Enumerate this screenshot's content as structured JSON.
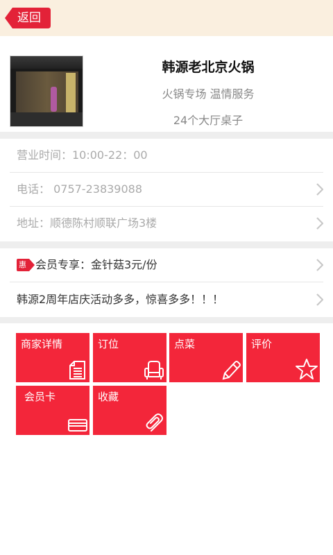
{
  "header": {
    "back_label": "返回"
  },
  "store": {
    "name": "韩源老北京火锅",
    "tagline": "火锅专场 温情服务",
    "tables": "24个大厅桌子",
    "photo_icon": "storefront-photo"
  },
  "info": {
    "hours": "营业时间：10:00-22：00",
    "phone": "电话： 0757-23839088",
    "address": "地址：顺德陈村顺联广场3楼"
  },
  "promos": {
    "badge": "惠",
    "member_offer": "会员专享：金针菇3元/份",
    "anniversary": "韩源2周年店庆活动多多，惊喜多多！！！"
  },
  "actions": [
    {
      "label": "商家详情",
      "icon": "document-icon"
    },
    {
      "label": "订位",
      "icon": "armchair-icon"
    },
    {
      "label": "点菜",
      "icon": "pencil-icon"
    },
    {
      "label": "评价",
      "icon": "star-icon"
    },
    {
      "label": "会员卡",
      "icon": "card-icon"
    },
    {
      "label": "收藏",
      "icon": "paperclip-icon"
    }
  ],
  "colors": {
    "accent": "#f3263a",
    "header_bg": "#faefdf"
  }
}
